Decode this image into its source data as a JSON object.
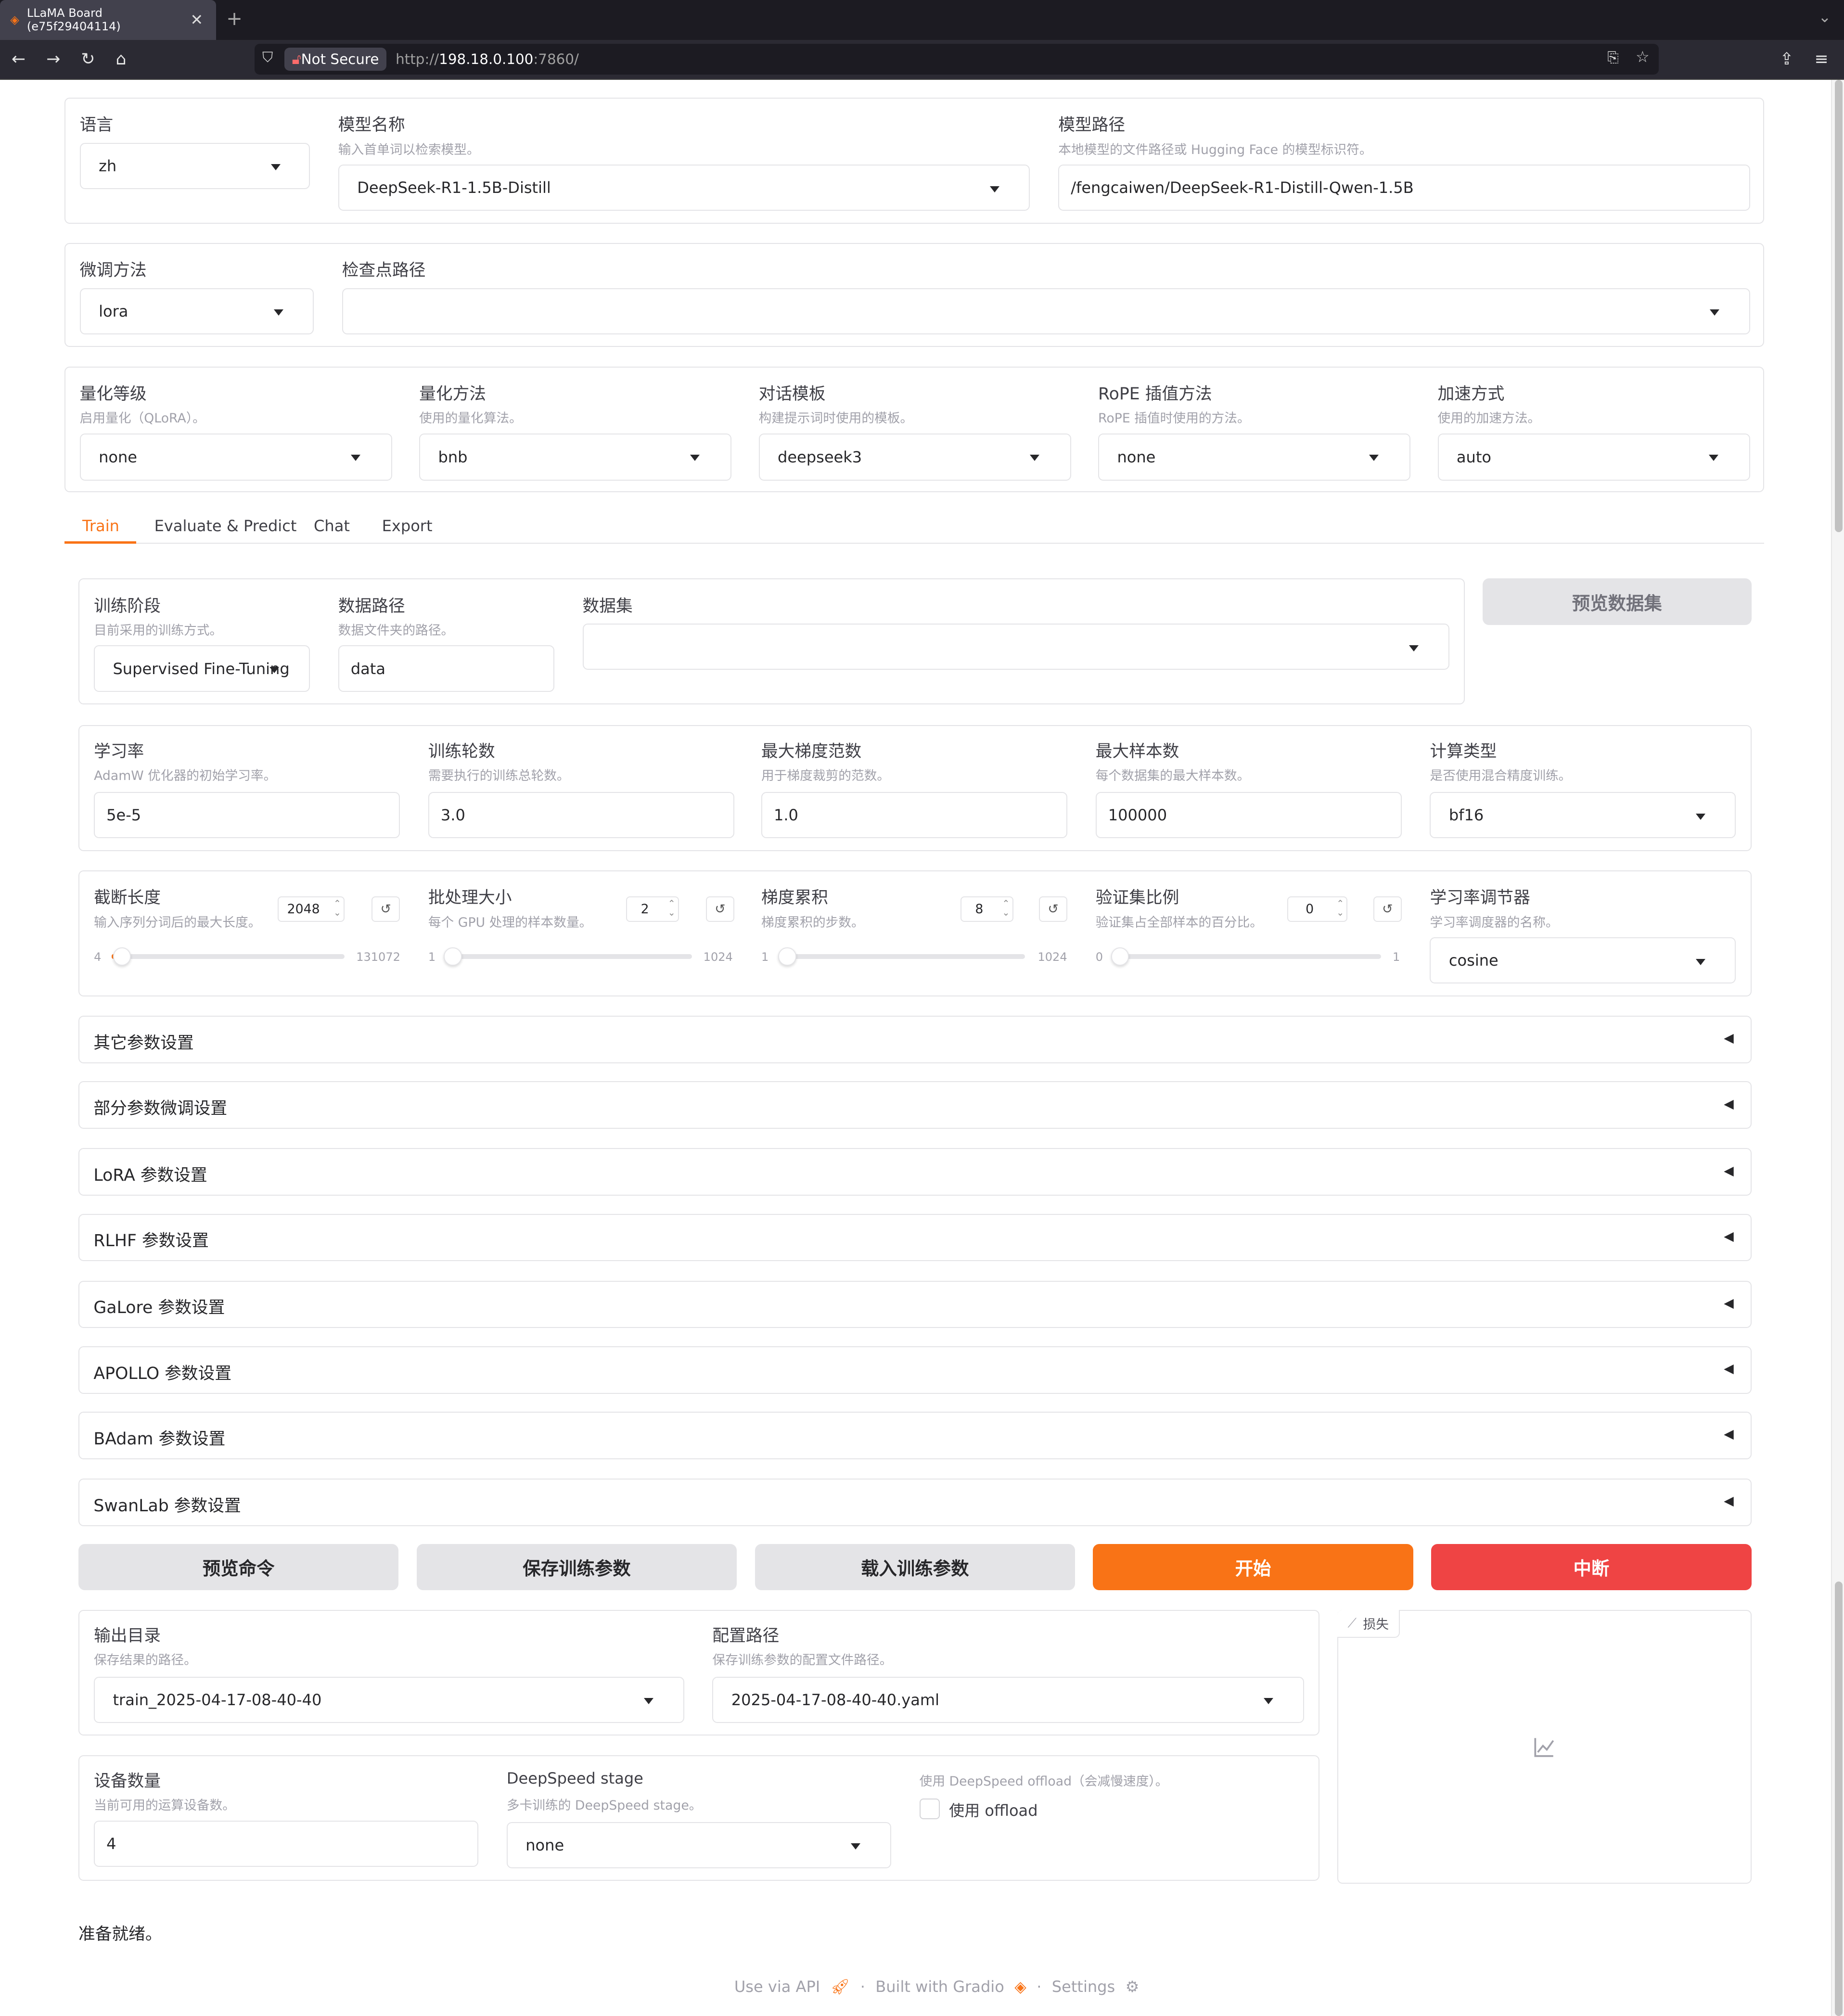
{
  "browser": {
    "tab_title": "LLaMA Board (e75f29404114)",
    "tab_close": "✕",
    "new_tab": "+",
    "not_secure": "Not Secure",
    "url_prefix": "http://",
    "url_host": "198.18.0.100",
    "url_suffix": ":7860/"
  },
  "top": {
    "lang": {
      "label": "语言",
      "value": "zh"
    },
    "model_name": {
      "label": "模型名称",
      "info": "输入首单词以检索模型。",
      "value": "DeepSeek-R1-1.5B-Distill"
    },
    "model_path": {
      "label": "模型路径",
      "info": "本地模型的文件路径或 Hugging Face 的模型标识符。",
      "value": "/fengcaiwen/DeepSeek-R1-Distill-Qwen-1.5B"
    },
    "finetune": {
      "label": "微调方法",
      "value": "lora"
    },
    "checkpoint": {
      "label": "检查点路径",
      "value": ""
    },
    "quant_bit": {
      "label": "量化等级",
      "info": "启用量化（QLoRA）。",
      "value": "none"
    },
    "quant_method": {
      "label": "量化方法",
      "info": "使用的量化算法。",
      "value": "bnb"
    },
    "template": {
      "label": "对话模板",
      "info": "构建提示词时使用的模板。",
      "value": "deepseek3"
    },
    "rope": {
      "label": "RoPE 插值方法",
      "info": "RoPE 插值时使用的方法。",
      "value": "none"
    },
    "booster": {
      "label": "加速方式",
      "info": "使用的加速方法。",
      "value": "auto"
    }
  },
  "tabs": [
    "Train",
    "Evaluate & Predict",
    "Chat",
    "Export"
  ],
  "train": {
    "stage": {
      "label": "训练阶段",
      "info": "目前采用的训练方式。",
      "value": "Supervised Fine-Tuning"
    },
    "dataset_dir": {
      "label": "数据路径",
      "info": "数据文件夹的路径。",
      "value": "data"
    },
    "dataset": {
      "label": "数据集",
      "value": ""
    },
    "preview_dataset": "预览数据集",
    "lr": {
      "label": "学习率",
      "info": "AdamW 优化器的初始学习率。",
      "value": "5e-5"
    },
    "epochs": {
      "label": "训练轮数",
      "info": "需要执行的训练总轮数。",
      "value": "3.0"
    },
    "max_grad_norm": {
      "label": "最大梯度范数",
      "info": "用于梯度裁剪的范数。",
      "value": "1.0"
    },
    "max_samples": {
      "label": "最大样本数",
      "info": "每个数据集的最大样本数。",
      "value": "100000"
    },
    "compute_type": {
      "label": "计算类型",
      "info": "是否使用混合精度训练。",
      "value": "bf16"
    },
    "cutoff": {
      "label": "截断长度",
      "info": "输入序列分词后的最大长度。",
      "value": "2048",
      "min": "4",
      "max": "131072",
      "fraction": 0.0156
    },
    "batch": {
      "label": "批处理大小",
      "info": "每个 GPU 处理的样本数量。",
      "value": "2",
      "min": "1",
      "max": "1024",
      "fraction": 0.001
    },
    "grad_acc": {
      "label": "梯度累积",
      "info": "梯度累积的步数。",
      "value": "8",
      "min": "1",
      "max": "1024",
      "fraction": 0.0068
    },
    "val_size": {
      "label": "验证集比例",
      "info": "验证集占全部样本的百分比。",
      "value": "0",
      "min": "0",
      "max": "1",
      "fraction": 0
    },
    "scheduler": {
      "label": "学习率调节器",
      "info": "学习率调度器的名称。",
      "value": "cosine"
    },
    "reset_icon": "↺",
    "accordions": [
      "其它参数设置",
      "部分参数微调设置",
      "LoRA 参数设置",
      "RLHF 参数设置",
      "GaLore 参数设置",
      "APOLLO 参数设置",
      "BAdam 参数设置",
      "SwanLab 参数设置"
    ],
    "acc_arrow": "◀",
    "buttons": {
      "preview_cmd": "预览命令",
      "save_args": "保存训练参数",
      "load_args": "载入训练参数",
      "start": "开始",
      "abort": "中断"
    },
    "output_dir": {
      "label": "输出目录",
      "info": "保存结果的路径。",
      "value": "train_2025-04-17-08-40-40"
    },
    "config_path": {
      "label": "配置路径",
      "info": "保存训练参数的配置文件路径。",
      "value": "2025-04-17-08-40-40.yaml"
    },
    "devices": {
      "label": "设备数量",
      "info": "当前可用的运算设备数。",
      "value": "4"
    },
    "ds_stage": {
      "label": "DeepSpeed stage",
      "info": "多卡训练的 DeepSpeed stage。",
      "value": "none"
    },
    "ds_offload": {
      "info": "使用 DeepSpeed offload（会减慢速度）。",
      "label": "使用 offload"
    },
    "loss_label": "损失",
    "status": "准备就绪。"
  },
  "footer": {
    "api": "Use via API",
    "built": "Built with Gradio",
    "settings": "Settings",
    "sep": "·"
  },
  "colors": {
    "accent": "#f97316",
    "danger": "#ef4444"
  }
}
